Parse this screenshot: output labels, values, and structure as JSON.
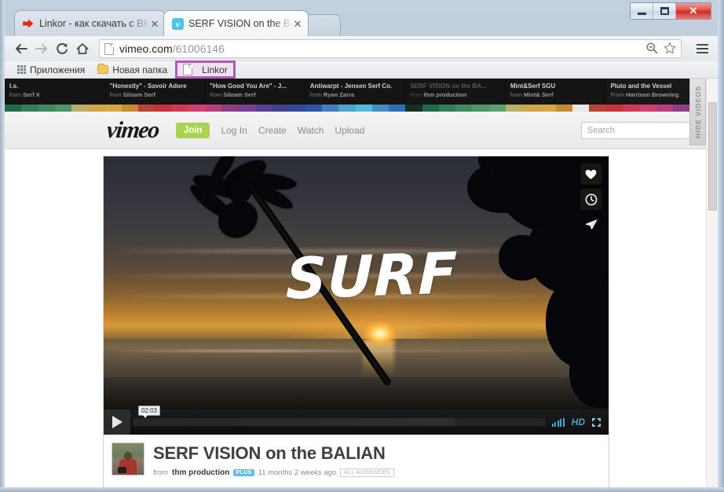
{
  "window": {
    "minimize_label": "Minimize",
    "maximize_label": "Restore",
    "close_label": "✕"
  },
  "tabs": [
    {
      "title": "Linkor - как скачать с ВК",
      "favicon": "red-arrow-icon",
      "close": "✕",
      "active": false
    },
    {
      "title": "SERF VISION on the BALIA",
      "favicon": "vimeo-icon",
      "close": "✕",
      "active": true
    }
  ],
  "toolbar": {
    "back_label": "←",
    "forward_label": "→",
    "reload_label": "⟳",
    "home_label": "⌂",
    "url_host": "vimeo.com",
    "url_path": "/61006146",
    "url_full": "vimeo.com/61006146",
    "zoom_icon_label": "zoom-out",
    "bookmark_icon_label": "☆",
    "menu_label": "Menu"
  },
  "bookmarks": [
    {
      "label": "Приложения",
      "icon": "apps-grid-icon"
    },
    {
      "label": "Новая папка",
      "icon": "folder-icon"
    },
    {
      "label": "Linkor",
      "icon": "page-icon",
      "highlighted": true
    }
  ],
  "video_strip": {
    "hide_label": "HIDE VIDEOS",
    "items": [
      {
        "title": "l.s.",
        "from_prefix": "from",
        "from": "Serf X",
        "dim": false
      },
      {
        "title": "\"Honestly\" - Savoir Adore",
        "from_prefix": "from",
        "from": "Siloam Serf",
        "dim": false
      },
      {
        "title": "\"How Good You Are\" - J...",
        "from_prefix": "from",
        "from": "Siloam Serf",
        "dim": false
      },
      {
        "title": "Antiwarpt - Jensen Serf Co.",
        "from_prefix": "from",
        "from": "Ryan Zarra",
        "dim": false
      },
      {
        "title": "SERF VISION on the BA...",
        "from_prefix": "from",
        "from": "thm production",
        "dim": true
      },
      {
        "title": "Mint&Serf SGU",
        "from_prefix": "from",
        "from": "Mint& Serf",
        "dim": false
      },
      {
        "title": "Pluto and the Vessel",
        "from_prefix": "From",
        "from": "Harrison Browning",
        "dim": false
      }
    ],
    "color_bars": [
      "#1d6b4a",
      "#2f7f57",
      "#3c8a5f",
      "#4d9469",
      "#b9b06a",
      "#d2a44b",
      "#dba63f",
      "#c88b38",
      "#b84438",
      "#c3343c",
      "#cf3a52",
      "#cf3f74",
      "#b83f7a",
      "#8d3f86",
      "#7a3d96",
      "#5a3f96",
      "#43418f",
      "#34489a",
      "#2f56a3",
      "#3f7fc0",
      "#4aa6cf",
      "#55bcd8",
      "#3f8fc4",
      "#2f6fb5",
      "#14311f",
      "#1d6b4a",
      "#2f7f57",
      "#3c8a5f",
      "#4d9469",
      "#5aa172",
      "#b9b06a",
      "#d2a44b",
      "#dba63f",
      "#c88b38",
      "#e8e8e8",
      "#b84438",
      "#c3343c",
      "#cf3a52",
      "#cf3f74",
      "#b83f7a",
      "#8d3f86",
      "#7a3d96"
    ]
  },
  "vimeo_header": {
    "logo": "vimeo",
    "join_label": "Join",
    "nav": [
      "Log In",
      "Create",
      "Watch",
      "Upload"
    ],
    "search_placeholder": "Search",
    "search_value": "",
    "mic_icon": "microphone-icon",
    "search_icon": "search-icon"
  },
  "player": {
    "overlay_text": "SURF",
    "play_label": "Play",
    "current_time": "02:03",
    "quality_badge": "HD",
    "volume_icon": "volume-bars-icon",
    "fullscreen_icon": "fullscreen-icon",
    "side_actions": [
      {
        "name": "like",
        "glyph": "♥"
      },
      {
        "name": "watch-later",
        "glyph": "🕘"
      },
      {
        "name": "share",
        "glyph": "➤"
      }
    ]
  },
  "video_info": {
    "title": "SERF VISION on the BALIAN",
    "from_prefix": "from",
    "author": "thm production",
    "plus_badge": "PLUS",
    "uploaded": "11 months 2 weeks ago",
    "audience_badge": "ALL AUDIENCES",
    "avatar_alt": "thm production avatar"
  },
  "colors": {
    "vimeo_green": "#aad450",
    "vimeo_blue": "#3fa9d4",
    "highlight_purple": "#b05ab0",
    "chrome_close_red": "#c62d27"
  }
}
